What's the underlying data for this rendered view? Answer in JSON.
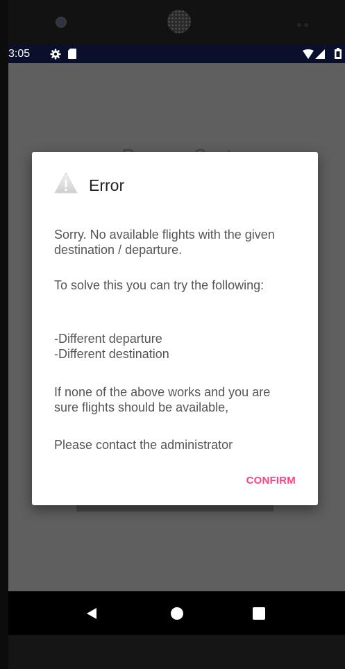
{
  "status_bar": {
    "time": "3:05",
    "icons": [
      "gear-icon",
      "sd-card-icon",
      "wifi-icon",
      "signal-icon",
      "battery-icon"
    ]
  },
  "background": {
    "screen_title": "Reserve Seat"
  },
  "dialog": {
    "icon": "warning-icon",
    "title": "Error",
    "messages": [
      "Sorry. No available flights with the given destination / departure.",
      "To solve this you can try  the following:",
      "-Different departure\n-Different destination",
      "If none of the above works and you are sure flights should be available,",
      "Please contact the administrator"
    ],
    "confirm_label": "CONFIRM"
  },
  "nav_bar": {
    "icons": [
      "back-icon",
      "home-icon",
      "recents-icon"
    ]
  },
  "colors": {
    "accent": "#ff4081",
    "status_bar": "#0a0f2b",
    "scrim": "#5f5f5f",
    "dialog_bg": "#ffffff"
  }
}
